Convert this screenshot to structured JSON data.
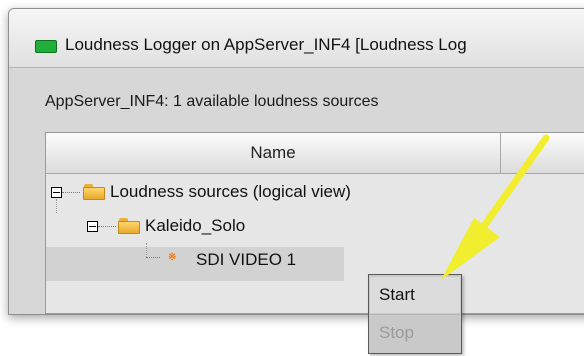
{
  "window": {
    "title": "Loudness Logger on AppServer_INF4 [Loudness Log"
  },
  "sources": {
    "summary": "AppServer_INF4: 1 available loudness sources"
  },
  "table": {
    "columns": [
      "Name"
    ],
    "rows": [
      {
        "label": "Loudness sources (logical view)",
        "level": 0,
        "type": "folder",
        "expanded": true
      },
      {
        "label": "Kaleido_Solo",
        "level": 1,
        "type": "folder",
        "expanded": true
      },
      {
        "label": "SDI VIDEO 1",
        "level": 2,
        "type": "source",
        "selected": true
      }
    ]
  },
  "context_menu": {
    "items": [
      {
        "label": "Start",
        "enabled": true
      },
      {
        "label": "Stop",
        "enabled": false
      }
    ]
  },
  "colors": {
    "annotation_arrow": "#f0ee2e",
    "status_icon": "#1faf3a",
    "feed_icon": "#f07a12"
  },
  "icons": [
    "monitor-status-icon",
    "folder-icon",
    "feed-icon",
    "expander-minus-icon"
  ]
}
